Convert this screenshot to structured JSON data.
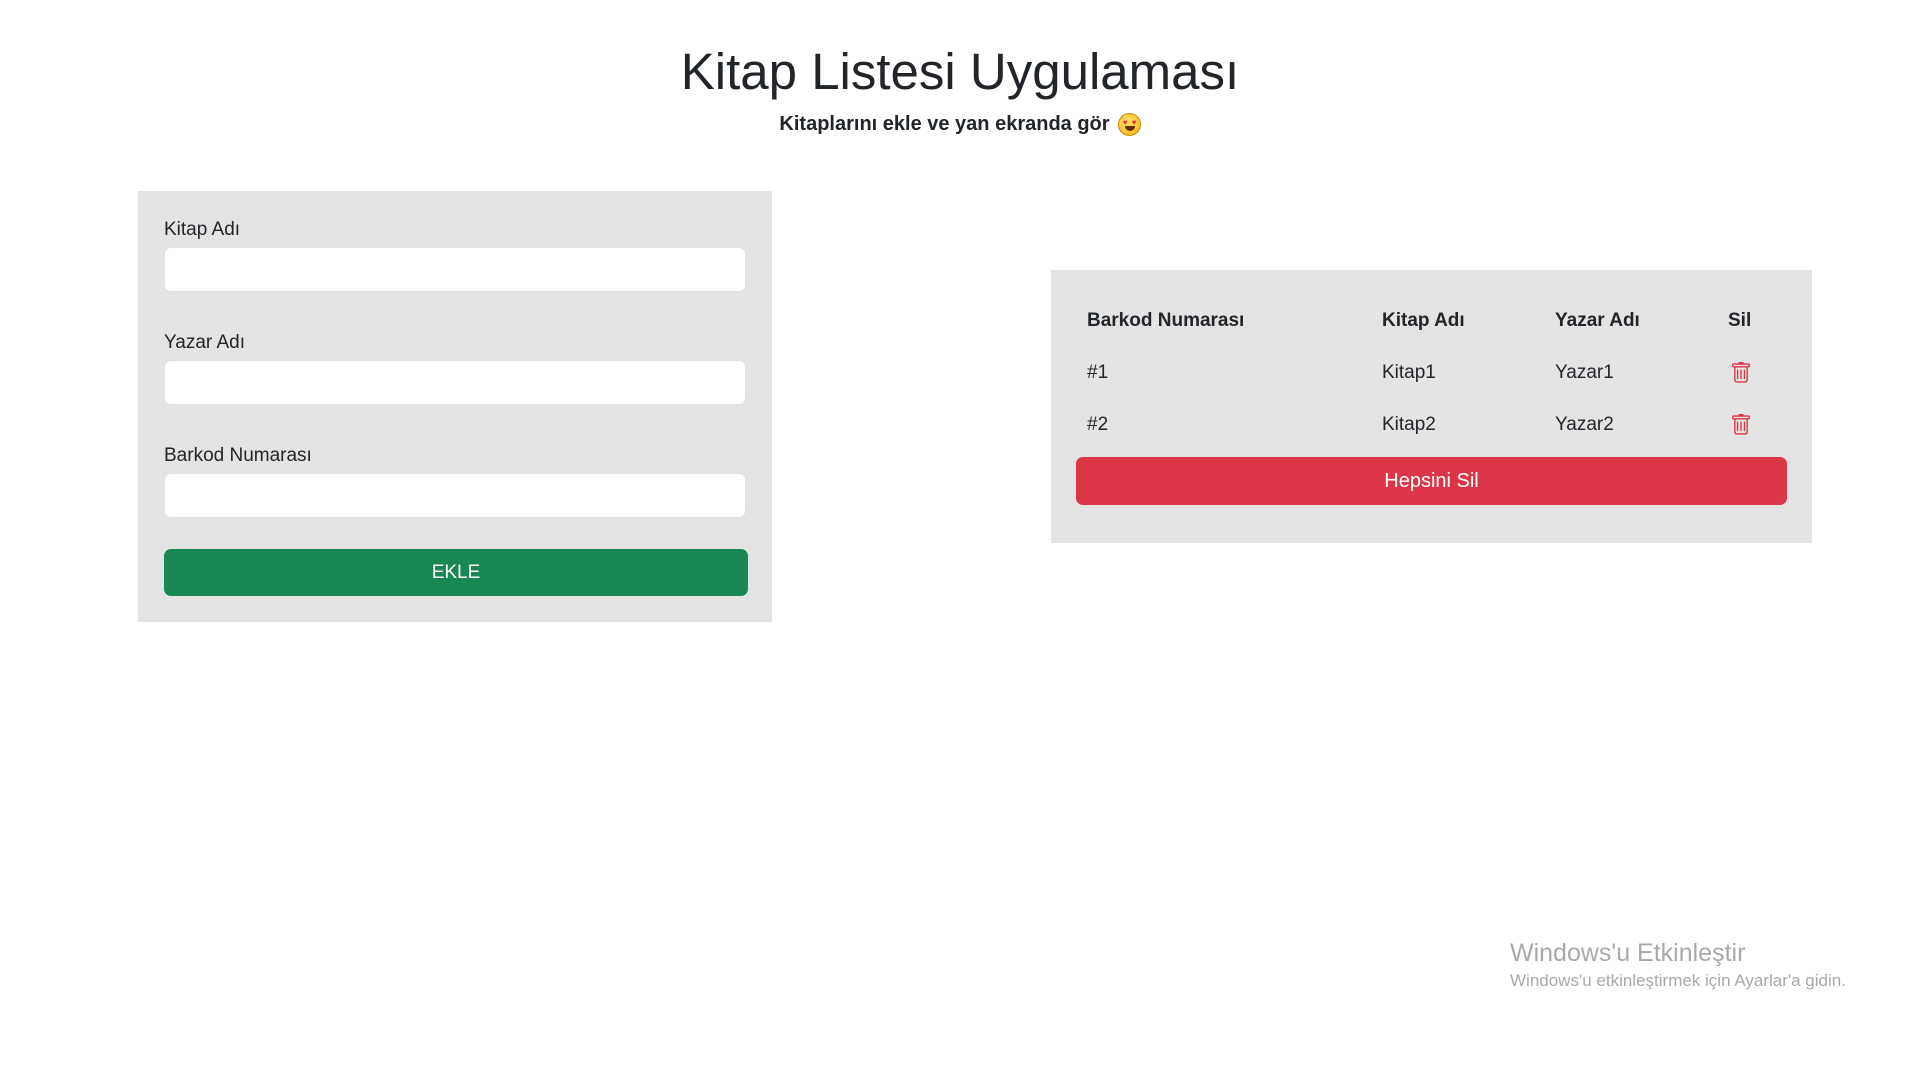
{
  "header": {
    "title": "Kitap Listesi Uygulaması",
    "subtitle": "Kitaplarını ekle ve yan ekranda gör"
  },
  "form": {
    "fields": [
      {
        "label": "Kitap Adı",
        "value": ""
      },
      {
        "label": "Yazar Adı",
        "value": ""
      },
      {
        "label": "Barkod Numarası",
        "value": ""
      }
    ],
    "submit_label": "EKLE"
  },
  "table": {
    "columns": [
      "Barkod Numarası",
      "Kitap Adı",
      "Yazar Adı",
      "Sil"
    ],
    "rows": [
      {
        "barcode": "#1",
        "title": "Kitap1",
        "author": "Yazar1"
      },
      {
        "barcode": "#2",
        "title": "Kitap2",
        "author": "Yazar2"
      }
    ],
    "delete_all_label": "Hepsini Sil"
  },
  "watermark": {
    "title": "Windows'u Etkinleştir",
    "subtitle": "Windows'u etkinleştirmek için Ayarlar'a gidin."
  },
  "icons": {
    "subtitle_emoji": "heart-eyes-emoji-icon",
    "row_delete": "trash-icon"
  },
  "colors": {
    "panel_bg": "#e4e4e4",
    "add_button": "#198754",
    "delete_all_button": "#dc3545",
    "trash_icon": "#dc3545",
    "watermark_text": "#a9a9a9"
  }
}
